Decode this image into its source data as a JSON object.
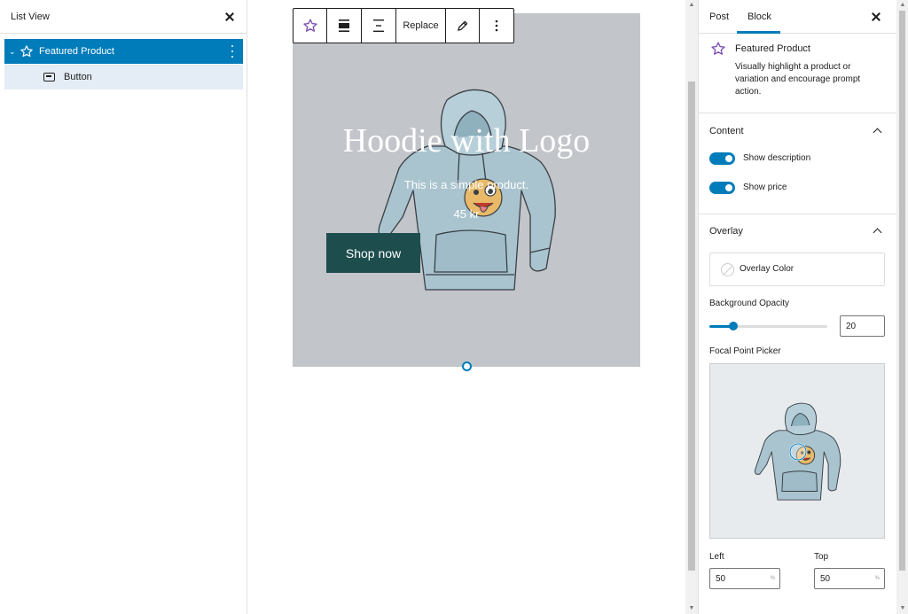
{
  "list_view": {
    "title": "List View",
    "items": [
      {
        "label": "Featured Product",
        "icon": "star-icon",
        "selected": true
      },
      {
        "label": "Button",
        "icon": "button-icon",
        "selected": false
      }
    ]
  },
  "toolbar": {
    "replace_label": "Replace"
  },
  "block": {
    "title": "Hoodie with Logo",
    "description": "This is a simple product.",
    "price": "45 kr",
    "button_label": "Shop now",
    "background_color": "#c2c5ca",
    "button_color": "#1e4d4e"
  },
  "sidebar": {
    "tabs": [
      {
        "label": "Post",
        "active": false
      },
      {
        "label": "Block",
        "active": true
      }
    ],
    "block_card": {
      "title": "Featured Product",
      "description": "Visually highlight a product or variation and encourage prompt action."
    },
    "content_panel": {
      "title": "Content",
      "toggles": [
        {
          "label": "Show description",
          "checked": true
        },
        {
          "label": "Show price",
          "checked": true
        }
      ]
    },
    "overlay_panel": {
      "title": "Overlay",
      "overlay_color_label": "Overlay Color",
      "opacity_label": "Background Opacity",
      "opacity_value": "20",
      "focal_label": "Focal Point Picker",
      "left_label": "Left",
      "left_value": "50",
      "top_label": "Top",
      "top_value": "50",
      "unit": "%"
    }
  },
  "colors": {
    "accent": "#007cba",
    "text": "#1e1e1e"
  }
}
